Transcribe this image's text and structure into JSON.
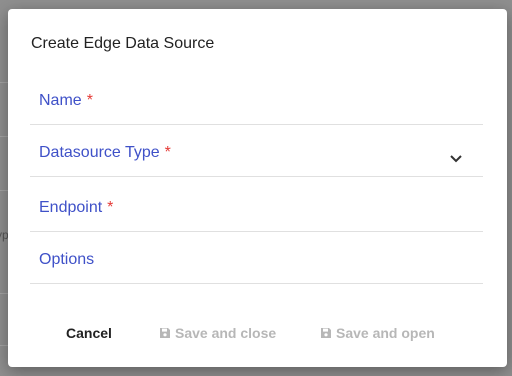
{
  "dialog": {
    "title": "Create Edge Data Source",
    "fields": [
      {
        "label": "Name",
        "required": "*"
      },
      {
        "label": "Datasource Type",
        "required": "*"
      },
      {
        "label": "Endpoint",
        "required": "*"
      },
      {
        "label": "Options"
      }
    ],
    "actions": {
      "cancel_label": "Cancel",
      "save_close_label": "Save and close",
      "save_open_label": "Save and open"
    }
  },
  "background": {
    "partial_text": "yp"
  },
  "icons": {
    "dropdown": "chevron-down-icon",
    "save": "floppy-disk-icon"
  },
  "colors": {
    "label": "#3f51c8",
    "required": "#e53935",
    "disabled": "#b7b7b7"
  }
}
